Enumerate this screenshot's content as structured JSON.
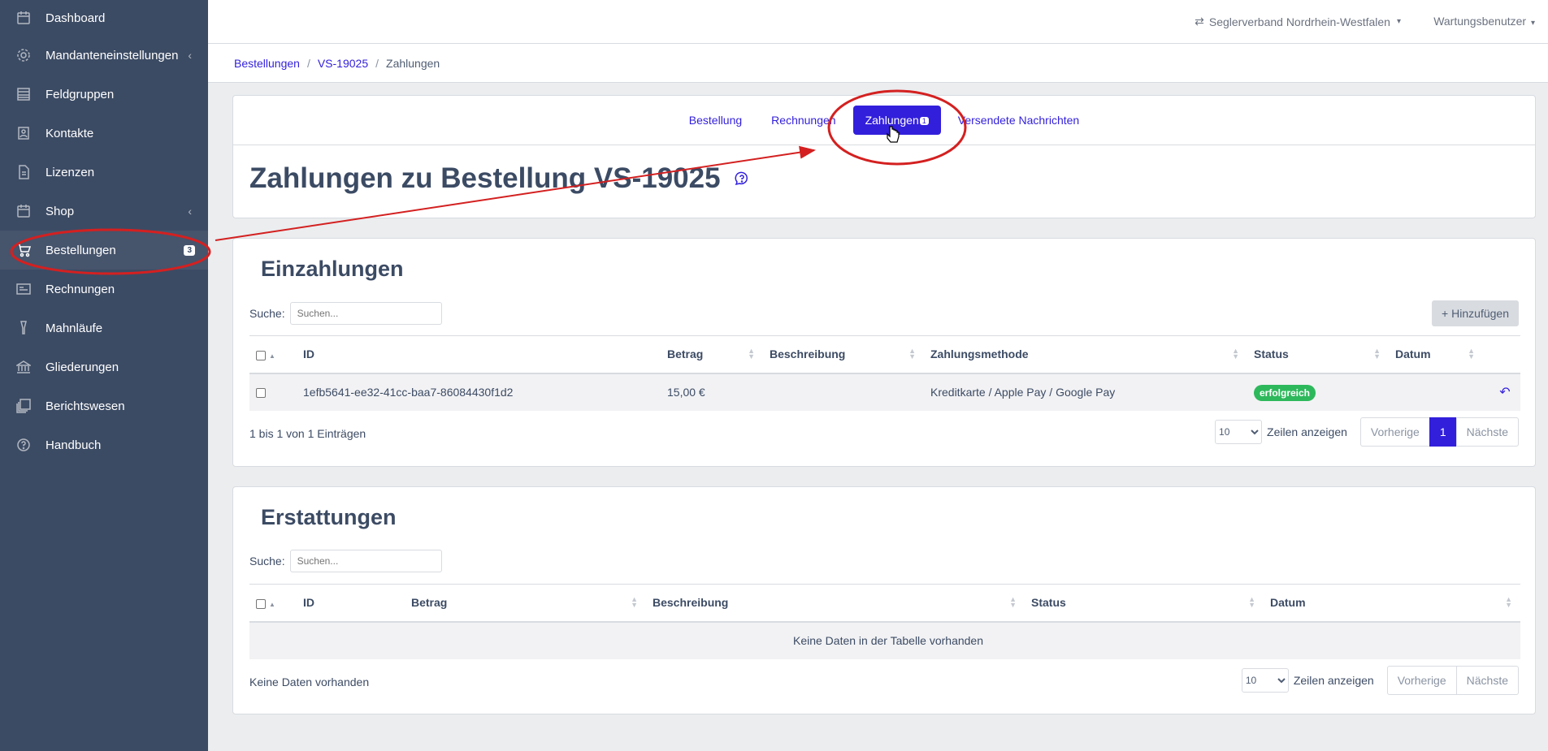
{
  "sidebar": {
    "items": [
      {
        "label": "Dashboard",
        "icon": "calendar-icon"
      },
      {
        "label": "Mandanteneinstellungen",
        "icon": "gear-icon",
        "chevron": "‹"
      },
      {
        "label": "Feldgruppen",
        "icon": "list-icon"
      },
      {
        "label": "Kontakte",
        "icon": "contacts-icon"
      },
      {
        "label": "Lizenzen",
        "icon": "document-icon"
      },
      {
        "label": "Shop",
        "icon": "calendar-icon",
        "chevron": "‹"
      },
      {
        "label": "Bestellungen",
        "icon": "cart-icon",
        "badge": "3",
        "active": true
      },
      {
        "label": "Rechnungen",
        "icon": "newspaper-icon"
      },
      {
        "label": "Mahnläufe",
        "icon": "reminder-icon"
      },
      {
        "label": "Gliederungen",
        "icon": "bank-icon"
      },
      {
        "label": "Berichtswesen",
        "icon": "library-icon"
      },
      {
        "label": "Handbuch",
        "icon": "help-icon"
      }
    ]
  },
  "header": {
    "organization": "Seglerverband Nordrhein-Westfalen",
    "user": "Wartungsbenutzer"
  },
  "breadcrumb": {
    "items": [
      "Bestellungen",
      "VS-19025"
    ],
    "current": "Zahlungen"
  },
  "tabs": {
    "items": [
      "Bestellung",
      "Rechnungen",
      "Zahlungen",
      "Versendete Nachrichten"
    ],
    "active_badge": "1"
  },
  "page_title": "Zahlungen zu Bestellung VS-19025",
  "einzahlungen": {
    "title": "Einzahlungen",
    "search_label": "Suche:",
    "search_placeholder": "Suchen...",
    "add_label": "Hinzufügen",
    "columns": [
      "ID",
      "Betrag",
      "Beschreibung",
      "Zahlungsmethode",
      "Status",
      "Datum"
    ],
    "rows": [
      {
        "id": "1efb5641-ee32-41cc-baa7-86084430f1d2",
        "betrag": "15,00 €",
        "beschreibung": "",
        "methode": "Kreditkarte / Apple Pay / Google Pay",
        "status": "erfolgreich",
        "datum": ""
      }
    ],
    "info": "1 bis 1 von 1 Einträgen",
    "page_size": "10",
    "page_size_label": "Zeilen anzeigen",
    "prev": "Vorherige",
    "page": "1",
    "next": "Nächste"
  },
  "erstattungen": {
    "title": "Erstattungen",
    "search_label": "Suche:",
    "search_placeholder": "Suchen...",
    "columns": [
      "ID",
      "Betrag",
      "Beschreibung",
      "Status",
      "Datum"
    ],
    "empty": "Keine Daten in der Tabelle vorhanden",
    "info": "Keine Daten vorhanden",
    "page_size": "10",
    "page_size_label": "Zeilen anzeigen",
    "prev": "Vorherige",
    "next": "Nächste"
  },
  "colors": {
    "primary": "#321fdb",
    "sidebar": "#3c4b64",
    "success": "#2eb85c",
    "annotation": "#d42020"
  }
}
